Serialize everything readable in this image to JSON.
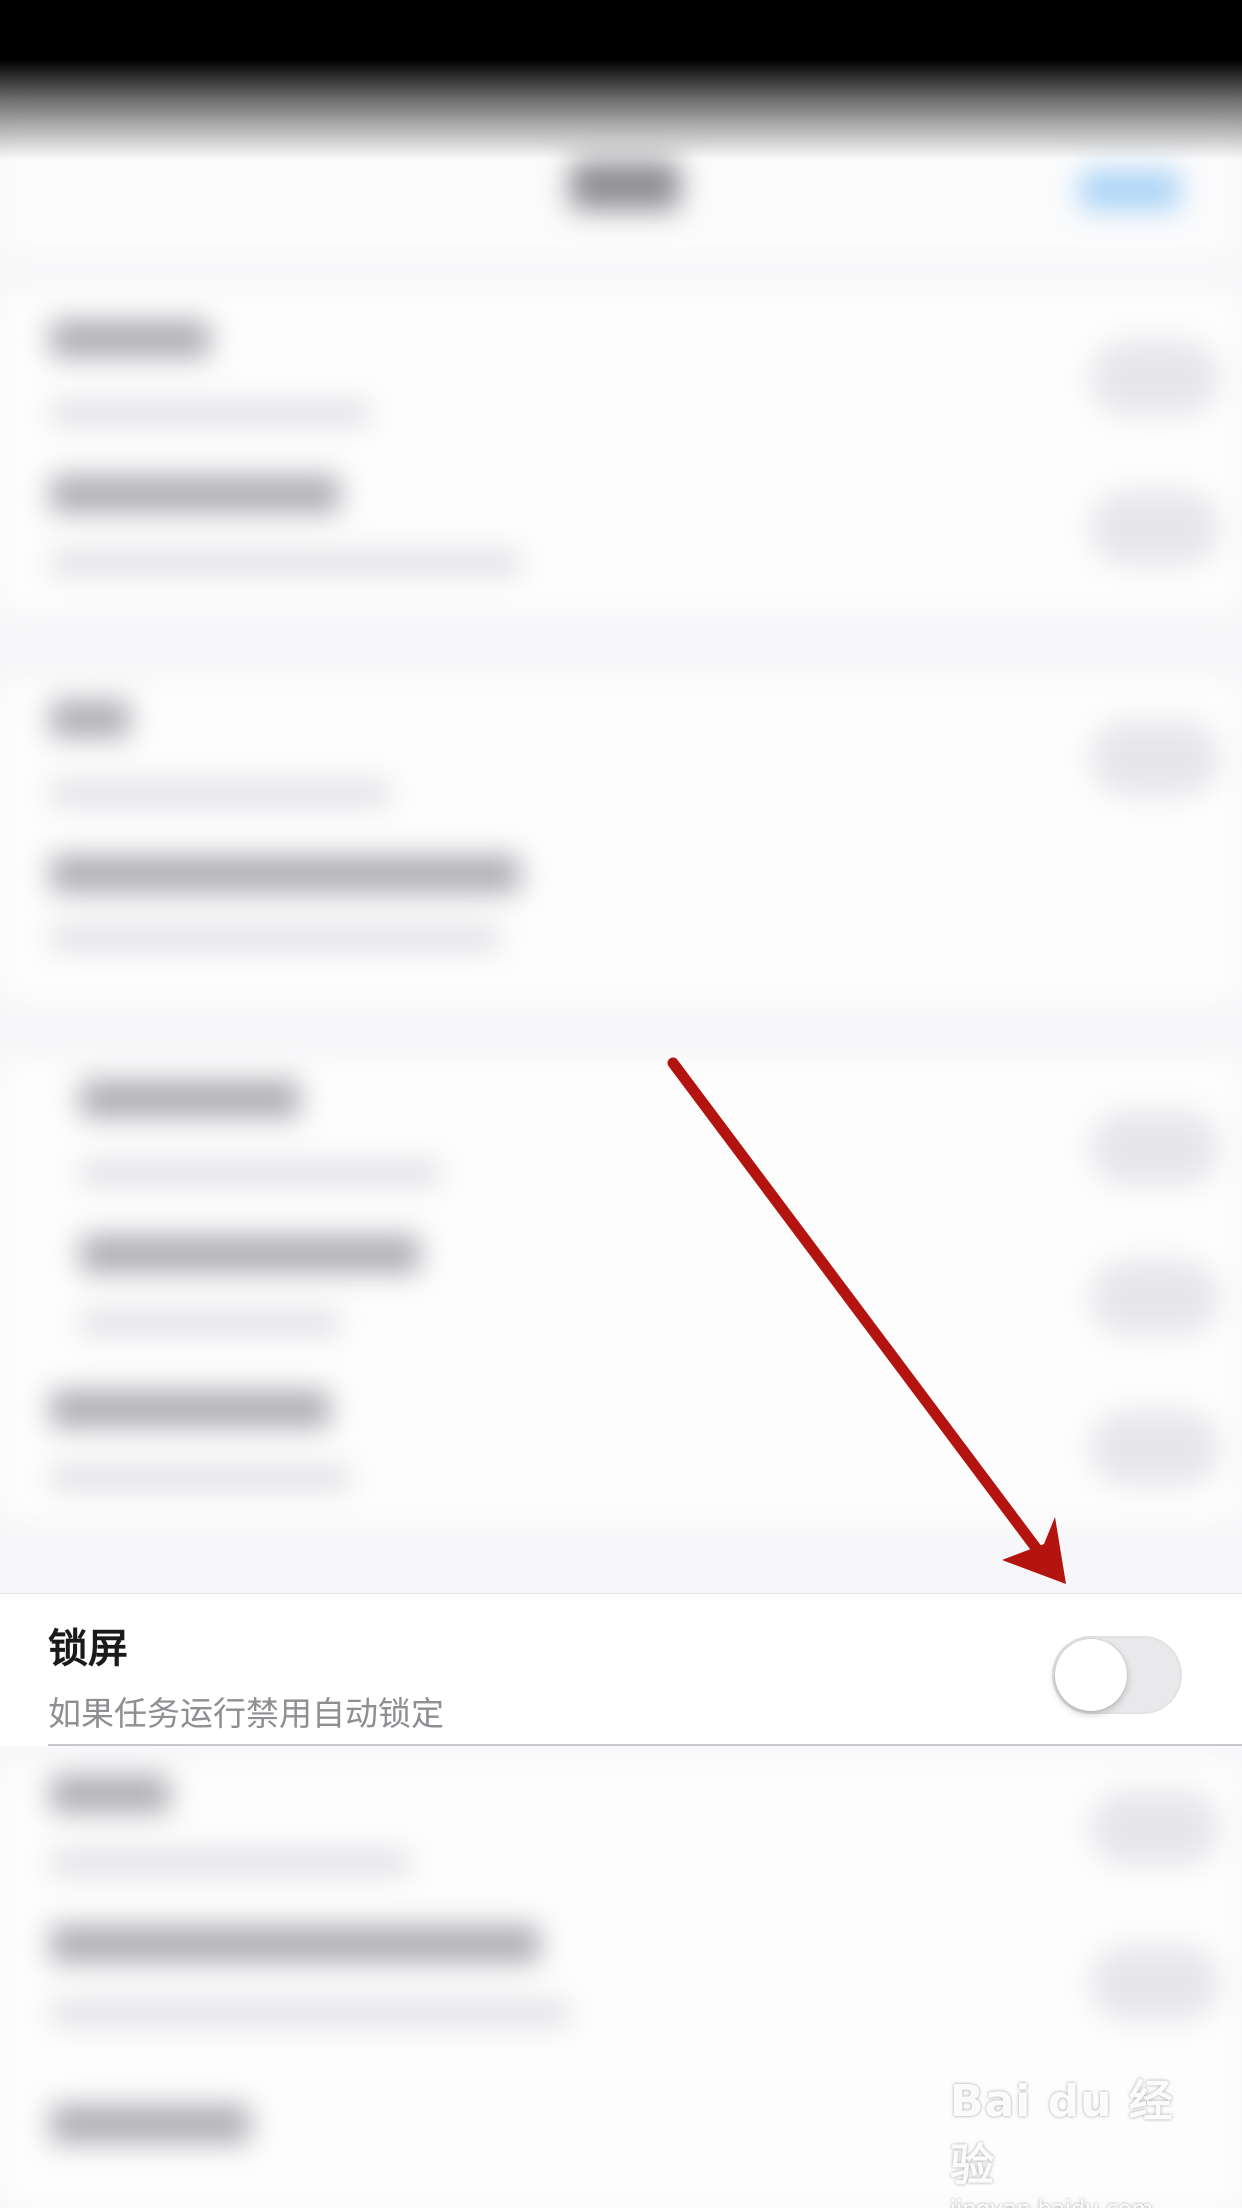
{
  "setting_row": {
    "title": "锁屏",
    "subtitle": "如果任务运行禁用自动锁定",
    "toggle_on": false
  },
  "watermark": {
    "brand": "Bai du 经验",
    "url": "jingyan.baidu.com"
  },
  "colors": {
    "arrow": "#b3140f",
    "toggle_track_off": "#e9e9eb",
    "background": "#f7f7f9"
  }
}
